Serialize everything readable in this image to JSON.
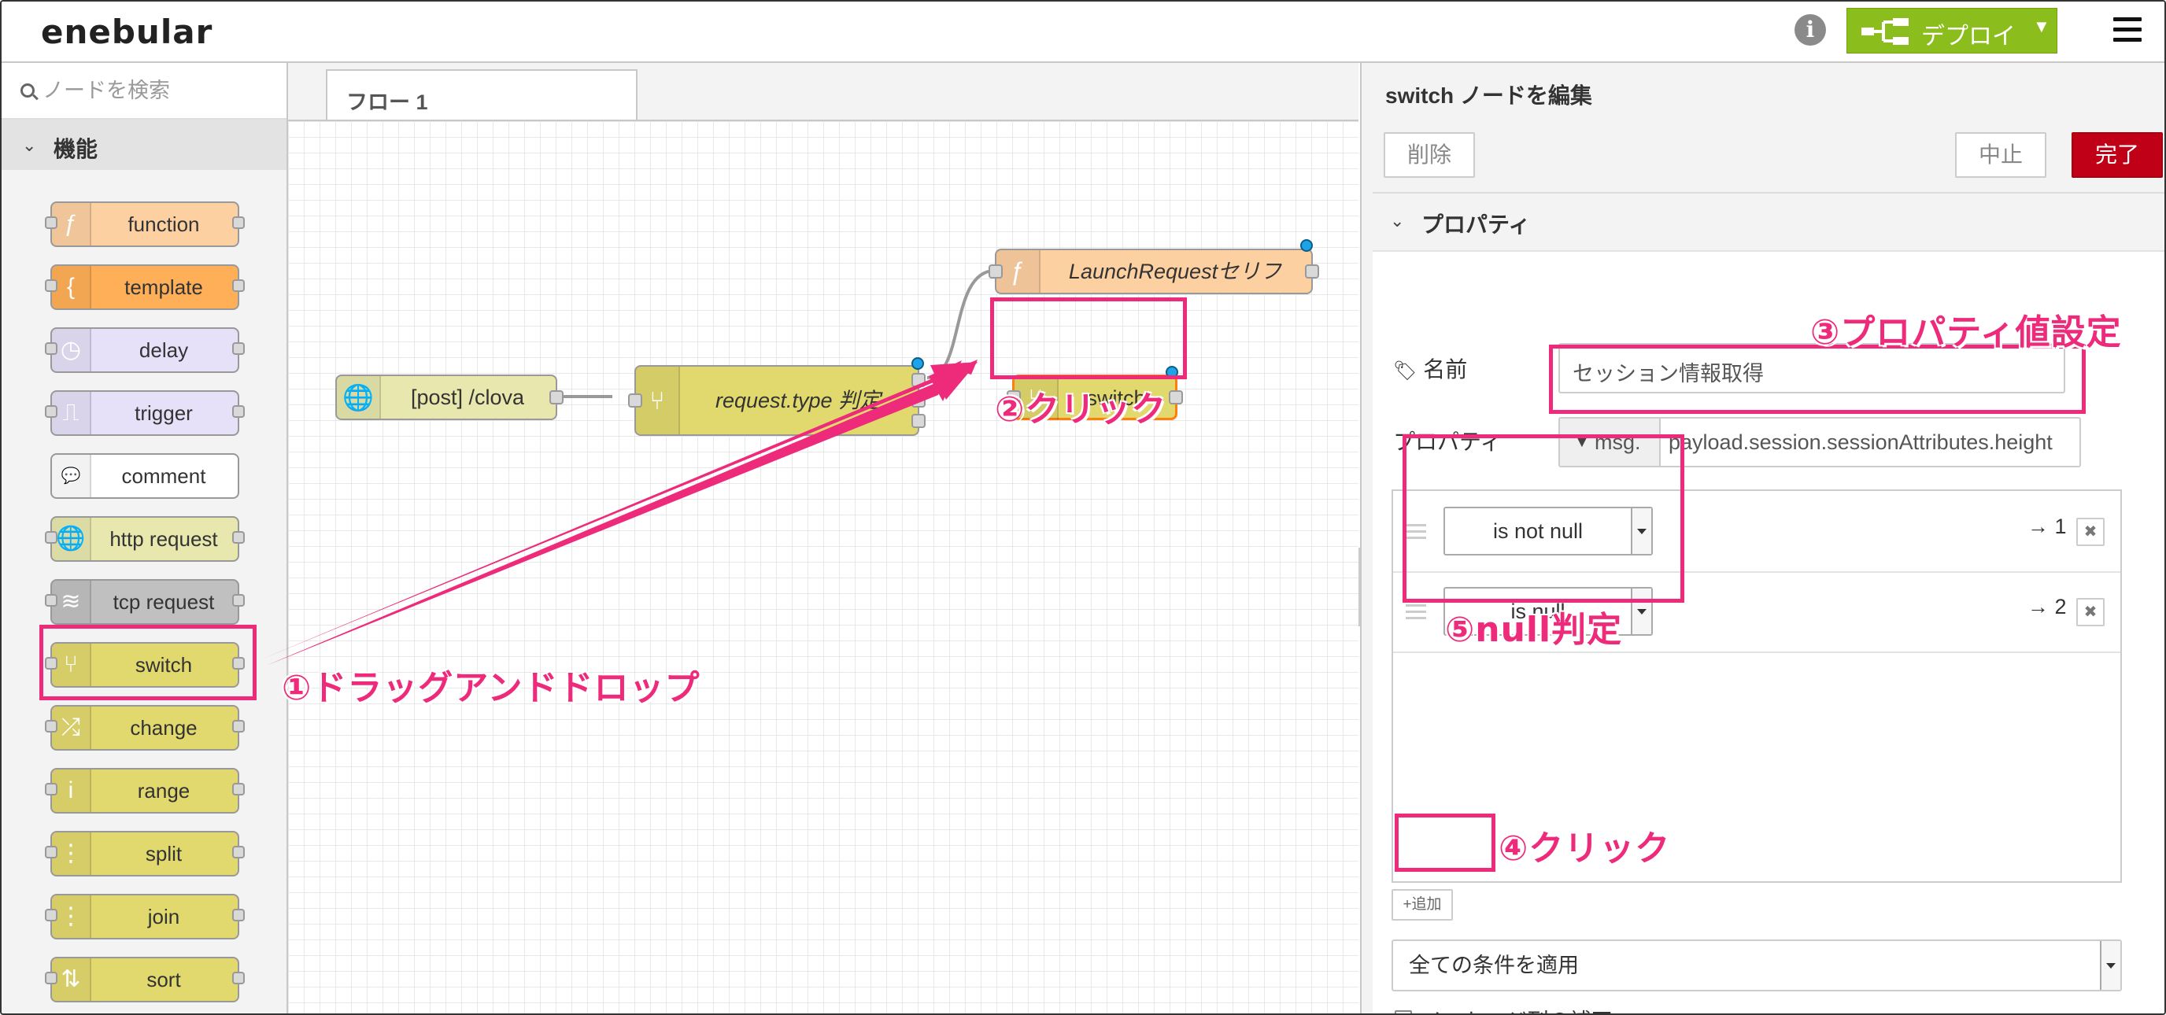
{
  "app": {
    "logo": "enebular"
  },
  "header": {
    "info_glyph": "i",
    "deploy_label": "デプロイ"
  },
  "palette": {
    "search_placeholder": "ノードを検索",
    "category": "機能",
    "nodes": [
      {
        "label": "function",
        "icon": "function-icon",
        "color": "#fdd0a2",
        "glyph": "ƒ"
      },
      {
        "label": "template",
        "icon": "template-icon",
        "color": "#ffaf57",
        "glyph": "{"
      },
      {
        "label": "delay",
        "icon": "delay-icon",
        "color": "#e6e0f8",
        "glyph": "◷"
      },
      {
        "label": "trigger",
        "icon": "trigger-icon",
        "color": "#e6e0f8",
        "glyph": "⎍"
      },
      {
        "label": "comment",
        "icon": "comment-icon",
        "color": "#ffffff",
        "glyph": "💬"
      },
      {
        "label": "http request",
        "icon": "http-request-icon",
        "color": "#e7e7ae",
        "glyph": "🌐"
      },
      {
        "label": "tcp request",
        "icon": "tcp-request-icon",
        "color": "#c0c0c0",
        "glyph": "≋"
      },
      {
        "label": "switch",
        "icon": "switch-icon",
        "color": "#e2d96e",
        "glyph": "⑂"
      },
      {
        "label": "change",
        "icon": "change-icon",
        "color": "#e2d96e",
        "glyph": "⤮"
      },
      {
        "label": "range",
        "icon": "range-icon",
        "color": "#e2d96e",
        "glyph": "i"
      },
      {
        "label": "split",
        "icon": "split-icon",
        "color": "#e2d96e",
        "glyph": "⋮"
      },
      {
        "label": "join",
        "icon": "join-icon",
        "color": "#e2d96e",
        "glyph": "⋮"
      },
      {
        "label": "sort",
        "icon": "sort-icon",
        "color": "#e2d96e",
        "glyph": "⇅"
      }
    ]
  },
  "workspace": {
    "tab": "フロー 1",
    "nodes": {
      "http_in": {
        "label": "[post] /clova",
        "color": "#e7e7ae"
      },
      "request_switch": {
        "label": "request.type 判定",
        "color": "#e2d96e"
      },
      "launch_function": {
        "label": "LaunchRequestセリフ",
        "color": "#fdd0a2"
      },
      "new_switch": {
        "label": "switch",
        "color": "#e2d96e"
      }
    }
  },
  "editor": {
    "title": "switch ノードを編集",
    "delete_label": "削除",
    "cancel_label": "中止",
    "done_label": "完了",
    "section": "プロパティ",
    "name_label": "名前",
    "name_value": "セッション情報取得",
    "property_label": "プロパティ",
    "property_type": "msg.",
    "property_value": "payload.session.sessionAttributes.height",
    "rules": [
      {
        "operator": "is not null",
        "output": "→ 1"
      },
      {
        "operator": "is null",
        "output": "→ 2"
      }
    ],
    "remove_glyph": "✖",
    "add_label": "+追加",
    "check_all": "全ての条件を適用",
    "recreate_sequences": "メッセージ列の補正"
  },
  "annotations": {
    "a1": "①ドラッグアンドドロップ",
    "a2": "②クリック",
    "a3": "③プロパティ値設定",
    "a4": "④クリック",
    "a5": "⑤null判定"
  },
  "colors": {
    "annotation": "#ee2a7b",
    "deploy": "#8bbd1d",
    "done": "#c00016",
    "port_dot": "#1fa3e8"
  }
}
